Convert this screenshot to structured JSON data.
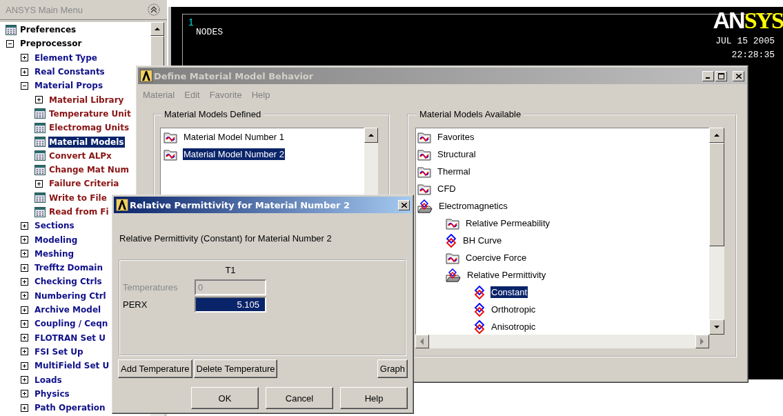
{
  "main_menu": {
    "title": "ANSYS Main Menu",
    "items": [
      {
        "label": "Preferences",
        "kind": "leaf",
        "selected": false
      },
      {
        "label": "Preprocessor",
        "kind": "branch",
        "expanded": true,
        "selected": false,
        "children": [
          {
            "label": "Element Type",
            "kind": "branch",
            "expanded": false,
            "selected": false
          },
          {
            "label": "Real Constants",
            "kind": "branch",
            "expanded": false,
            "selected": false
          },
          {
            "label": "Material Props",
            "kind": "branch",
            "expanded": true,
            "selected": false,
            "children": [
              {
                "label": "Material Library",
                "kind": "branch",
                "expanded": false,
                "selected": false
              },
              {
                "label": "Temperature Unit",
                "kind": "leaf",
                "selected": false
              },
              {
                "label": "Electromag Units",
                "kind": "leaf",
                "selected": false
              },
              {
                "label": "Material Models",
                "kind": "leaf",
                "selected": true
              },
              {
                "label": "Convert ALPx",
                "kind": "leaf",
                "selected": false
              },
              {
                "label": "Change Mat Num",
                "kind": "leaf",
                "selected": false
              },
              {
                "label": "Failure Criteria",
                "kind": "branch",
                "expanded": false,
                "selected": false
              },
              {
                "label": "Write to File",
                "kind": "leaf",
                "selected": false
              },
              {
                "label": "Read from Fi",
                "kind": "leaf",
                "selected": false
              }
            ]
          },
          {
            "label": "Sections",
            "kind": "branch",
            "expanded": false,
            "selected": false
          },
          {
            "label": "Modeling",
            "kind": "branch",
            "expanded": false,
            "selected": false
          },
          {
            "label": "Meshing",
            "kind": "branch",
            "expanded": false,
            "selected": false
          },
          {
            "label": "Trefftz Domain",
            "kind": "branch",
            "expanded": false,
            "selected": false
          },
          {
            "label": "Checking Ctrls",
            "kind": "branch",
            "expanded": false,
            "selected": false
          },
          {
            "label": "Numbering Ctrl",
            "kind": "branch",
            "expanded": false,
            "selected": false
          },
          {
            "label": "Archive Model",
            "kind": "branch",
            "expanded": false,
            "selected": false
          },
          {
            "label": "Coupling / Ceqn",
            "kind": "branch",
            "expanded": false,
            "selected": false
          },
          {
            "label": "FLOTRAN Set U",
            "kind": "branch",
            "expanded": false,
            "selected": false
          },
          {
            "label": "FSI Set Up",
            "kind": "branch",
            "expanded": false,
            "selected": false
          },
          {
            "label": "MultiField Set U",
            "kind": "branch",
            "expanded": false,
            "selected": false
          },
          {
            "label": "Loads",
            "kind": "branch",
            "expanded": false,
            "selected": false
          },
          {
            "label": "Physics",
            "kind": "branch",
            "expanded": false,
            "selected": false
          },
          {
            "label": "Path Operation",
            "kind": "branch",
            "expanded": false,
            "selected": false
          }
        ]
      }
    ]
  },
  "graphics": {
    "window_number": "1",
    "label": "NODES",
    "logo": {
      "white_part": "AN",
      "yellow_part": "SYS"
    },
    "date": "JUL 15 2005",
    "time": "22:28:35"
  },
  "define_window": {
    "title": "Define Material Model Behavior",
    "menu": [
      "Material",
      "Edit",
      "Favorite",
      "Help"
    ],
    "defined": {
      "title": "Material Models Defined",
      "items": [
        {
          "label": "Material Model Number 1",
          "selected": false
        },
        {
          "label": "Material Model Number 2",
          "selected": true
        }
      ]
    },
    "available": {
      "title": "Material Models Available",
      "items": [
        {
          "label": "Favorites",
          "kind": "folder",
          "expanded": false,
          "selected": false
        },
        {
          "label": "Structural",
          "kind": "folder",
          "expanded": false,
          "selected": false
        },
        {
          "label": "Thermal",
          "kind": "folder",
          "expanded": false,
          "selected": false
        },
        {
          "label": "CFD",
          "kind": "folder",
          "expanded": false,
          "selected": false
        },
        {
          "label": "Electromagnetics",
          "kind": "folder",
          "expanded": true,
          "selected": false,
          "children": [
            {
              "label": "Relative Permeability",
              "kind": "folder",
              "expanded": false,
              "selected": false
            },
            {
              "label": "BH Curve",
              "kind": "model",
              "selected": false
            },
            {
              "label": "Coercive Force",
              "kind": "folder",
              "expanded": false,
              "selected": false
            },
            {
              "label": "Relative Permittivity",
              "kind": "folder",
              "expanded": true,
              "selected": false,
              "children": [
                {
                  "label": "Constant",
                  "kind": "model",
                  "selected": true
                },
                {
                  "label": "Orthotropic",
                  "kind": "model",
                  "selected": false
                },
                {
                  "label": "Anisotropic",
                  "kind": "model",
                  "selected": false
                }
              ]
            }
          ]
        }
      ]
    }
  },
  "permittivity_dialog": {
    "title": "Relative Permittivity for Material Number 2",
    "message": "Relative Permittivity (Constant) for Material Number 2",
    "table": {
      "column": "T1",
      "rows": [
        {
          "label": "Temperatures",
          "value": "0",
          "disabled": true,
          "selected": false
        },
        {
          "label": "PERX",
          "value": "5.105",
          "disabled": false,
          "selected": true
        }
      ]
    },
    "row_buttons": [
      "Add Temperature",
      "Delete Temperature"
    ],
    "graph_button": "Graph",
    "buttons": [
      "OK",
      "Cancel",
      "Help"
    ]
  }
}
